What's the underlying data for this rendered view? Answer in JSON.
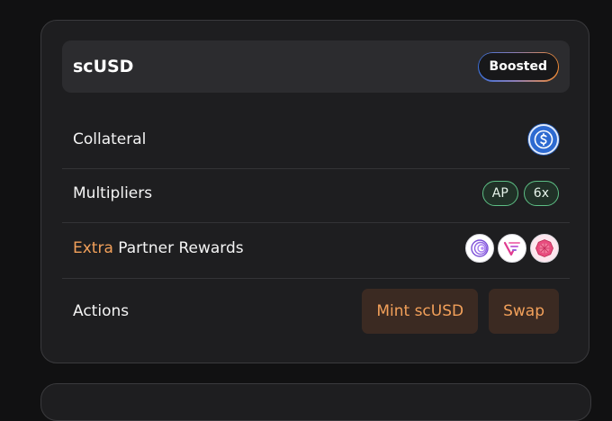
{
  "header": {
    "title": "scUSD",
    "badge": "Boosted"
  },
  "rows": {
    "collateral": {
      "label": "Collateral",
      "icon": "usdc-coin-icon"
    },
    "multipliers": {
      "label": "Multipliers",
      "pills": [
        "AP",
        "6x"
      ]
    },
    "partner_rewards": {
      "label_accent": "Extra",
      "label_rest": " Partner Rewards",
      "icons": [
        "partner-spiral-icon",
        "partner-wave-icon",
        "partner-gem-icon"
      ]
    },
    "actions": {
      "label": "Actions",
      "buttons": [
        "Mint scUSD",
        "Swap"
      ]
    }
  },
  "colors": {
    "accent": "#f2a05a",
    "pill_border": "#5dbf85",
    "usdc_blue": "#2d6ad1",
    "card_bg": "#1e1e20"
  }
}
